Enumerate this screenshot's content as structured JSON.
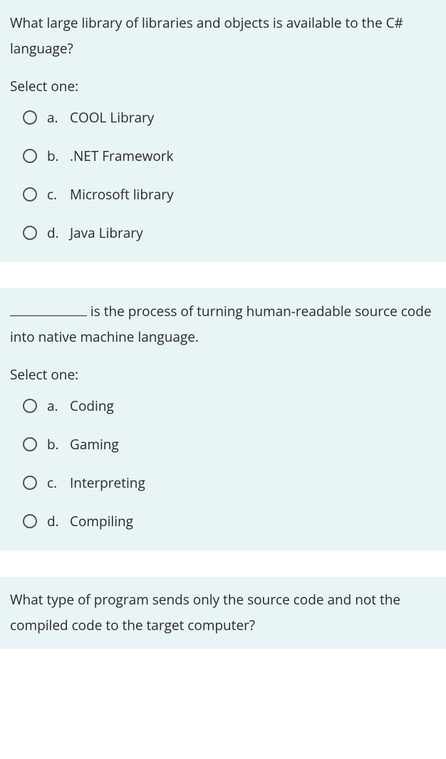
{
  "questions": [
    {
      "text": "What large library of libraries and objects is available to the C# language?",
      "has_blank": false,
      "select_prompt": "Select one:",
      "options": [
        {
          "letter": "a.",
          "label": "COOL Library"
        },
        {
          "letter": "b.",
          "label": ".NET Framework"
        },
        {
          "letter": "c.",
          "label": "Microsoft library"
        },
        {
          "letter": "d.",
          "label": "Java Library"
        }
      ]
    },
    {
      "text": " is the process of turning human-readable source code into native machine language.",
      "has_blank": true,
      "select_prompt": "Select one:",
      "options": [
        {
          "letter": "a.",
          "label": "Coding"
        },
        {
          "letter": "b.",
          "label": "Gaming"
        },
        {
          "letter": "c.",
          "label": "Interpreting"
        },
        {
          "letter": "d.",
          "label": "Compiling"
        }
      ]
    },
    {
      "text": "What type of program sends only the source code and not the compiled code to the target computer?",
      "has_blank": false,
      "select_prompt": "",
      "options": []
    }
  ]
}
